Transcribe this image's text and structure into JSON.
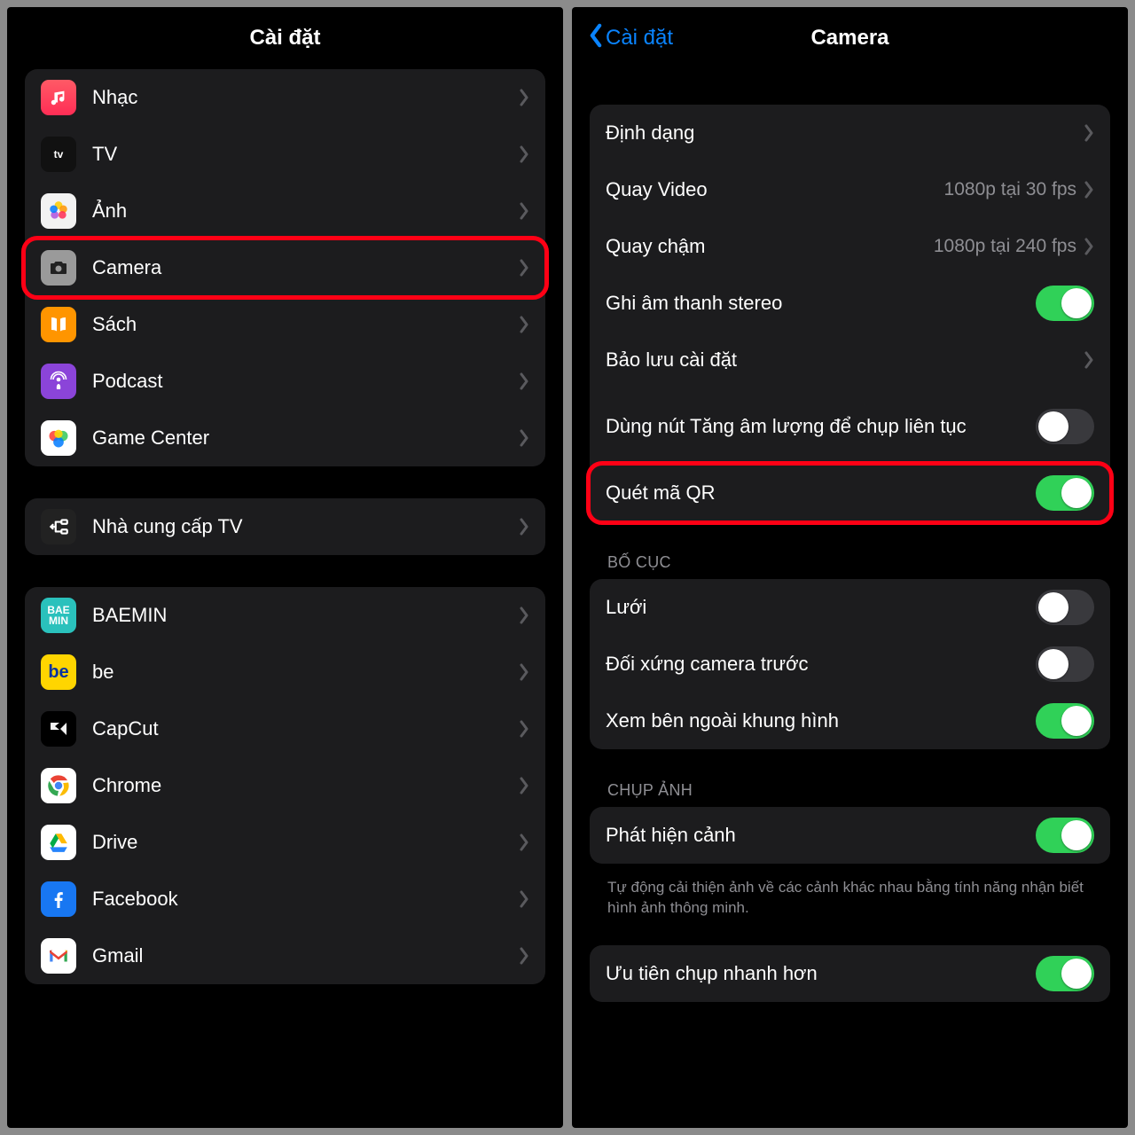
{
  "left": {
    "title": "Cài đặt",
    "groups": [
      {
        "items": [
          {
            "id": "music",
            "label": "Nhạc"
          },
          {
            "id": "tv",
            "label": "TV"
          },
          {
            "id": "photos",
            "label": "Ảnh"
          },
          {
            "id": "camera",
            "label": "Camera",
            "highlight": true
          },
          {
            "id": "books",
            "label": "Sách"
          },
          {
            "id": "podcast",
            "label": "Podcast"
          },
          {
            "id": "gc",
            "label": "Game Center"
          }
        ]
      },
      {
        "items": [
          {
            "id": "prov",
            "label": "Nhà cung cấp TV"
          }
        ]
      },
      {
        "items": [
          {
            "id": "baemin",
            "label": "BAEMIN"
          },
          {
            "id": "be",
            "label": "be"
          },
          {
            "id": "capcut",
            "label": "CapCut"
          },
          {
            "id": "chrome",
            "label": "Chrome"
          },
          {
            "id": "drive",
            "label": "Drive"
          },
          {
            "id": "fb",
            "label": "Facebook"
          },
          {
            "id": "gmail",
            "label": "Gmail"
          }
        ]
      }
    ]
  },
  "right": {
    "back": "Cài đặt",
    "title": "Camera",
    "groups": [
      {
        "items": [
          {
            "id": "format",
            "label": "Định dạng",
            "chev": true
          },
          {
            "id": "recvid",
            "label": "Quay Video",
            "value": "1080p tại 30 fps",
            "chev": true
          },
          {
            "id": "slomo",
            "label": "Quay chậm",
            "value": "1080p tại 240 fps",
            "chev": true
          },
          {
            "id": "stereo",
            "label": "Ghi âm thanh stereo",
            "toggle": true,
            "on": true
          },
          {
            "id": "preserve",
            "label": "Bảo lưu cài đặt",
            "chev": true
          },
          {
            "id": "volburst",
            "label": "Dùng nút Tăng âm lượng để chụp liên tục",
            "toggle": true,
            "on": false,
            "tall": true
          },
          {
            "id": "qr",
            "label": "Quét mã QR",
            "toggle": true,
            "on": true,
            "highlight": true
          }
        ]
      },
      {
        "header": "BỐ CỤC",
        "items": [
          {
            "id": "grid",
            "label": "Lưới",
            "toggle": true,
            "on": false
          },
          {
            "id": "mirror",
            "label": "Đối xứng camera trước",
            "toggle": true,
            "on": false
          },
          {
            "id": "outside",
            "label": "Xem bên ngoài khung hình",
            "toggle": true,
            "on": true
          }
        ]
      },
      {
        "header": "CHỤP ẢNH",
        "items": [
          {
            "id": "scene",
            "label": "Phát hiện cảnh",
            "toggle": true,
            "on": true
          }
        ],
        "footer": "Tự động cải thiện ảnh về các cảnh khác nhau bằng tính năng nhận biết hình ảnh thông minh."
      },
      {
        "items": [
          {
            "id": "fastshot",
            "label": "Ưu tiên chụp nhanh hơn",
            "toggle": true,
            "on": true
          }
        ]
      }
    ]
  }
}
